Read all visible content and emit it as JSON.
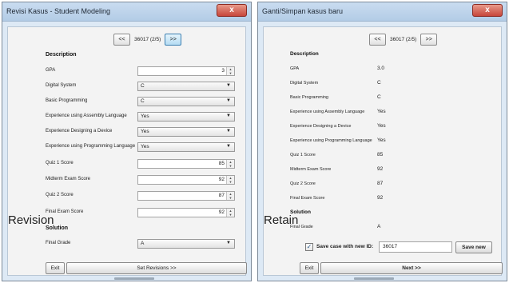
{
  "left_window": {
    "title": "Revisi Kasus - Student Modeling",
    "close_label": "x",
    "side_label": "Revision",
    "nav": {
      "prev": "<<",
      "position": "36017 (2/5)",
      "next": ">>"
    },
    "section_description": "Description",
    "fields": [
      {
        "label": "GPA",
        "value": "3"
      },
      {
        "label": "Digital System",
        "value": "C"
      },
      {
        "label": "Basic Programming",
        "value": "C"
      },
      {
        "label": "Experience using Assembly Language",
        "value": "Yes"
      },
      {
        "label": "Experience Designing a Device",
        "value": "Yes"
      },
      {
        "label": "Experience using Programming Language",
        "value": "Yes"
      },
      {
        "label": "Quiz 1 Score",
        "value": "85"
      },
      {
        "label": "Midterm Exam Score",
        "value": "92"
      },
      {
        "label": "Quiz 2 Score",
        "value": "87"
      },
      {
        "label": "Final Exam Score",
        "value": "92"
      }
    ],
    "section_solution": "Solution",
    "final_grade": {
      "label": "Final Grade",
      "value": "A"
    },
    "exit_label": "Exit",
    "set_revisions_label": "Set Revisions >>"
  },
  "right_window": {
    "title": "Ganti/Simpan kasus baru",
    "close_label": "x",
    "side_label": "Retain",
    "nav": {
      "prev": "<<",
      "position": "36017 (2/5)",
      "next": ">>"
    },
    "section_description": "Description",
    "fields": [
      {
        "label": "GPA",
        "value": "3.0"
      },
      {
        "label": "Digital System",
        "value": "C"
      },
      {
        "label": "Basic Programming",
        "value": "C"
      },
      {
        "label": "Experience using Assembly Language",
        "value": "Yes"
      },
      {
        "label": "Experience Designing a Device",
        "value": "Yes"
      },
      {
        "label": "Experience using Programming Language",
        "value": "Yes"
      },
      {
        "label": "Quiz 1 Score",
        "value": "85"
      },
      {
        "label": "Midterm Exam Score",
        "value": "92"
      },
      {
        "label": "Quiz 2 Score",
        "value": "87"
      },
      {
        "label": "Final Exam Score",
        "value": "92"
      }
    ],
    "section_solution": "Solution",
    "final_grade": {
      "label": "Final Grade",
      "value": "A"
    },
    "save_checkbox_label": "Save case with new ID:",
    "save_checkbox_checked": true,
    "new_id_value": "36017",
    "save_new_label": "Save new",
    "exit_label": "Exit",
    "next_label": "Next  >>"
  }
}
